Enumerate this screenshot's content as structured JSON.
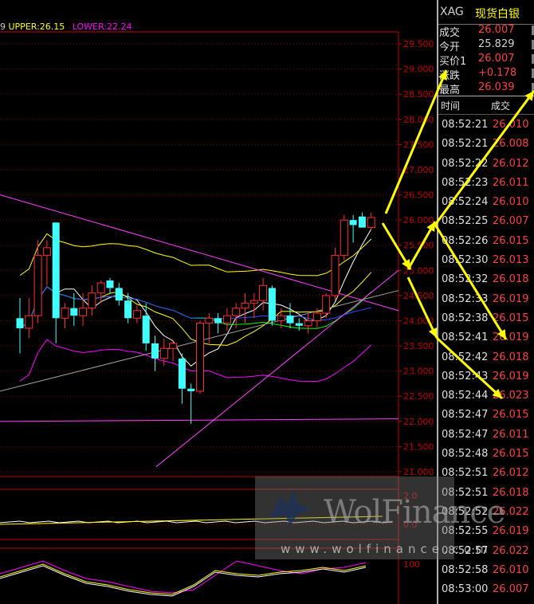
{
  "legend": {
    "cut": "9",
    "upper": "UPPER:26.15",
    "lower": "LOWER:22.24"
  },
  "price_axis": [
    "29.500",
    "29.000",
    "28.500",
    "28.000",
    "27.500",
    "27.000",
    "26.500",
    "26.000",
    "25.500",
    "25.000",
    "24.500",
    "24.000",
    "23.500",
    "23.000",
    "22.500",
    "22.000",
    "21.500",
    "21.000"
  ],
  "volume_axis": [
    "2.0",
    "0.0"
  ],
  "kdj_axis": [
    "100"
  ],
  "panel": {
    "symbol": "XAG",
    "name": "现货白银",
    "quote": [
      {
        "key": "成交",
        "value": "26.007"
      },
      {
        "key": "今开",
        "value": "25.829"
      },
      {
        "key": "买价1",
        "value": "26.007"
      },
      {
        "key": "涨跌",
        "value": "+0.178"
      },
      {
        "key": "最高",
        "value": "26.039"
      }
    ],
    "trade_header": {
      "time": "时间",
      "price": "成交"
    },
    "trades": [
      {
        "time": "08:52:21",
        "price": "26.010"
      },
      {
        "time": "08:52:21",
        "price": "26.008"
      },
      {
        "time": "08:52:22",
        "price": "26.012"
      },
      {
        "time": "08:52:23",
        "price": "26.011"
      },
      {
        "time": "08:52:24",
        "price": "26.010"
      },
      {
        "time": "08:52:25",
        "price": "26.007"
      },
      {
        "time": "08:52:26",
        "price": "26.015"
      },
      {
        "time": "08:52:30",
        "price": "26.013"
      },
      {
        "time": "08:52:32",
        "price": "26.018"
      },
      {
        "time": "08:52:33",
        "price": "26.019"
      },
      {
        "time": "08:52:38",
        "price": "26.015"
      },
      {
        "time": "08:52:41",
        "price": "26.019"
      },
      {
        "time": "08:52:42",
        "price": "26.018"
      },
      {
        "time": "08:52:43",
        "price": "26.019"
      },
      {
        "time": "08:52:44",
        "price": "26.023"
      },
      {
        "time": "08:52:47",
        "price": "26.015"
      },
      {
        "time": "08:52:47",
        "price": "26.011"
      },
      {
        "time": "08:52:48",
        "price": "26.015"
      },
      {
        "time": "08:52:51",
        "price": "26.012"
      },
      {
        "time": "08:52:51",
        "price": "26.018"
      },
      {
        "time": "08:52:52",
        "price": "26.022"
      },
      {
        "time": "08:52:55",
        "price": "26.019"
      },
      {
        "time": "08:52:57",
        "price": "26.022"
      },
      {
        "time": "08:52:58",
        "price": "26.010"
      },
      {
        "time": "08:53:00",
        "price": "26.007"
      }
    ]
  },
  "watermark": {
    "brand": "WolFinance",
    "url": "www.wolfinance.com"
  },
  "colors": {
    "up": "#ff3030",
    "down": "#40ffff",
    "upper_band": "#ffff00",
    "lower_band": "#ff00ff",
    "grid": "#8a0000",
    "arrow": "#ffff00"
  },
  "candles": [
    {
      "o": 24.05,
      "h": 24.45,
      "l": 23.35,
      "c": 23.85
    },
    {
      "o": 23.85,
      "h": 24.45,
      "l": 23.65,
      "c": 24.1
    },
    {
      "o": 24.1,
      "h": 25.6,
      "l": 23.95,
      "c": 25.3
    },
    {
      "o": 25.3,
      "h": 25.6,
      "l": 24.7,
      "c": 25.45
    },
    {
      "o": 25.95,
      "h": 25.95,
      "l": 23.55,
      "c": 24.05
    },
    {
      "o": 24.05,
      "h": 24.35,
      "l": 23.85,
      "c": 24.25
    },
    {
      "o": 24.25,
      "h": 24.55,
      "l": 23.9,
      "c": 24.1
    },
    {
      "o": 24.1,
      "h": 24.55,
      "l": 23.9,
      "c": 24.25
    },
    {
      "o": 24.25,
      "h": 24.7,
      "l": 24.1,
      "c": 24.55
    },
    {
      "o": 24.55,
      "h": 24.8,
      "l": 24.35,
      "c": 24.75
    },
    {
      "o": 24.8,
      "h": 24.85,
      "l": 24.55,
      "c": 24.65
    },
    {
      "o": 24.65,
      "h": 24.75,
      "l": 24.3,
      "c": 24.4
    },
    {
      "o": 24.4,
      "h": 24.55,
      "l": 23.95,
      "c": 24.05
    },
    {
      "o": 24.05,
      "h": 24.3,
      "l": 23.95,
      "c": 24.2
    },
    {
      "o": 24.1,
      "h": 24.35,
      "l": 23.4,
      "c": 23.55
    },
    {
      "o": 23.55,
      "h": 23.7,
      "l": 23.0,
      "c": 23.25
    },
    {
      "o": 23.25,
      "h": 23.65,
      "l": 23.1,
      "c": 23.45
    },
    {
      "o": 23.45,
      "h": 23.6,
      "l": 23.2,
      "c": 23.55
    },
    {
      "o": 23.25,
      "h": 23.35,
      "l": 22.35,
      "c": 22.65
    },
    {
      "o": 22.65,
      "h": 22.75,
      "l": 21.95,
      "c": 22.6
    },
    {
      "o": 22.6,
      "h": 24.0,
      "l": 22.55,
      "c": 23.95
    },
    {
      "o": 23.95,
      "h": 24.15,
      "l": 23.55,
      "c": 24.05
    },
    {
      "o": 24.05,
      "h": 24.15,
      "l": 23.75,
      "c": 23.95
    },
    {
      "o": 23.95,
      "h": 24.25,
      "l": 23.8,
      "c": 24.1
    },
    {
      "o": 24.1,
      "h": 24.35,
      "l": 23.85,
      "c": 24.25
    },
    {
      "o": 24.25,
      "h": 24.55,
      "l": 23.95,
      "c": 24.35
    },
    {
      "o": 24.35,
      "h": 24.55,
      "l": 24.05,
      "c": 24.4
    },
    {
      "o": 24.4,
      "h": 24.85,
      "l": 24.2,
      "c": 24.7
    },
    {
      "o": 24.65,
      "h": 24.7,
      "l": 23.9,
      "c": 24.0
    },
    {
      "o": 24.0,
      "h": 24.25,
      "l": 23.85,
      "c": 24.1
    },
    {
      "o": 24.1,
      "h": 24.35,
      "l": 23.85,
      "c": 23.95
    },
    {
      "o": 23.95,
      "h": 24.05,
      "l": 23.8,
      "c": 23.9
    },
    {
      "o": 23.9,
      "h": 24.15,
      "l": 23.75,
      "c": 24.0
    },
    {
      "o": 24.0,
      "h": 24.25,
      "l": 23.85,
      "c": 24.15
    },
    {
      "o": 24.15,
      "h": 24.55,
      "l": 24.05,
      "c": 24.5
    },
    {
      "o": 24.5,
      "h": 25.45,
      "l": 24.4,
      "c": 25.3
    },
    {
      "o": 25.3,
      "h": 26.1,
      "l": 25.2,
      "c": 26.0
    },
    {
      "o": 26.0,
      "h": 26.1,
      "l": 25.55,
      "c": 25.9
    },
    {
      "o": 26.07,
      "h": 26.15,
      "l": 25.85,
      "c": 25.85
    },
    {
      "o": 25.85,
      "h": 26.15,
      "l": 25.8,
      "c": 26.05
    }
  ]
}
